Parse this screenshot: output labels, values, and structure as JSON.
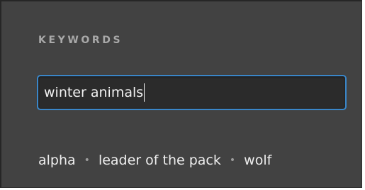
{
  "keywords": {
    "heading": "KEYWORDS",
    "input_value": "winter animals",
    "separator": "•",
    "suggestions": [
      "alpha",
      "leader of the pack",
      "wolf"
    ]
  },
  "colors": {
    "panel_bg": "#424242",
    "input_bg": "#2b2b2b",
    "focus_border": "#3a86c8",
    "heading_text": "#a9a9a9",
    "text": "#eeeeee"
  }
}
